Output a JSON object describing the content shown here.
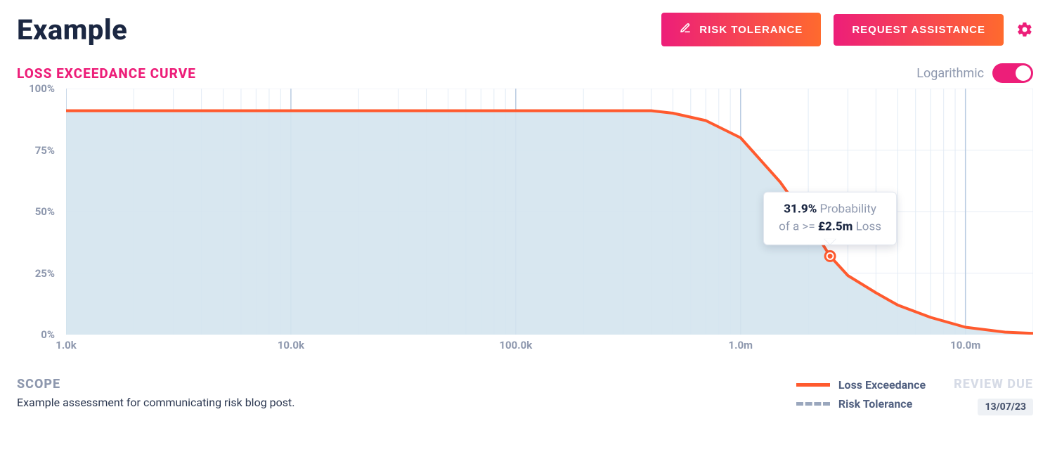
{
  "header": {
    "title": "Example",
    "risk_tolerance_btn": "RISK TOLERANCE",
    "request_assistance_btn": "REQUEST ASSISTANCE"
  },
  "sub": {
    "title": "LOSS EXCEEDANCE CURVE",
    "toggle_label": "Logarithmic",
    "toggle_on": true
  },
  "chart_data": {
    "type": "line",
    "title": "Loss Exceedance Curve",
    "ylabel": "Probability",
    "ylim": [
      0,
      100
    ],
    "x_scale": "log",
    "x_min": 1000,
    "x_max": 20000000,
    "x_ticks": [
      "1.0k",
      "10.0k",
      "100.0k",
      "1.0m",
      "10.0m"
    ],
    "y_ticks": [
      "0%",
      "25%",
      "50%",
      "75%",
      "100%"
    ],
    "series": [
      {
        "name": "Loss Exceedance",
        "style": "solid",
        "color": "#ff5a2e",
        "points": [
          {
            "x": 1000,
            "y": 91
          },
          {
            "x": 10000,
            "y": 91
          },
          {
            "x": 100000,
            "y": 91
          },
          {
            "x": 400000,
            "y": 91
          },
          {
            "x": 500000,
            "y": 90
          },
          {
            "x": 700000,
            "y": 87
          },
          {
            "x": 1000000,
            "y": 80
          },
          {
            "x": 1500000,
            "y": 62
          },
          {
            "x": 2000000,
            "y": 46
          },
          {
            "x": 2500000,
            "y": 31.9
          },
          {
            "x": 3000000,
            "y": 24
          },
          {
            "x": 4000000,
            "y": 17
          },
          {
            "x": 5000000,
            "y": 12
          },
          {
            "x": 7000000,
            "y": 7
          },
          {
            "x": 10000000,
            "y": 3
          },
          {
            "x": 15000000,
            "y": 1
          },
          {
            "x": 20000000,
            "y": 0.5
          }
        ]
      },
      {
        "name": "Risk Tolerance",
        "style": "dashed",
        "color": "#9aa7bd",
        "points": []
      }
    ],
    "annotations": [
      {
        "x": 2500000,
        "y": 31.9,
        "percent": "31.9%",
        "text_mid": "Probability of a >=",
        "amount": "£2.5m",
        "suffix": "Loss"
      }
    ]
  },
  "legend": {
    "loss_exceedance": "Loss Exceedance",
    "risk_tolerance": "Risk Tolerance"
  },
  "footer": {
    "scope_h": "SCOPE",
    "scope_t": "Example assessment for communicating risk blog post.",
    "review_h": "REVIEW DUE",
    "review_d": "13/07/23"
  }
}
